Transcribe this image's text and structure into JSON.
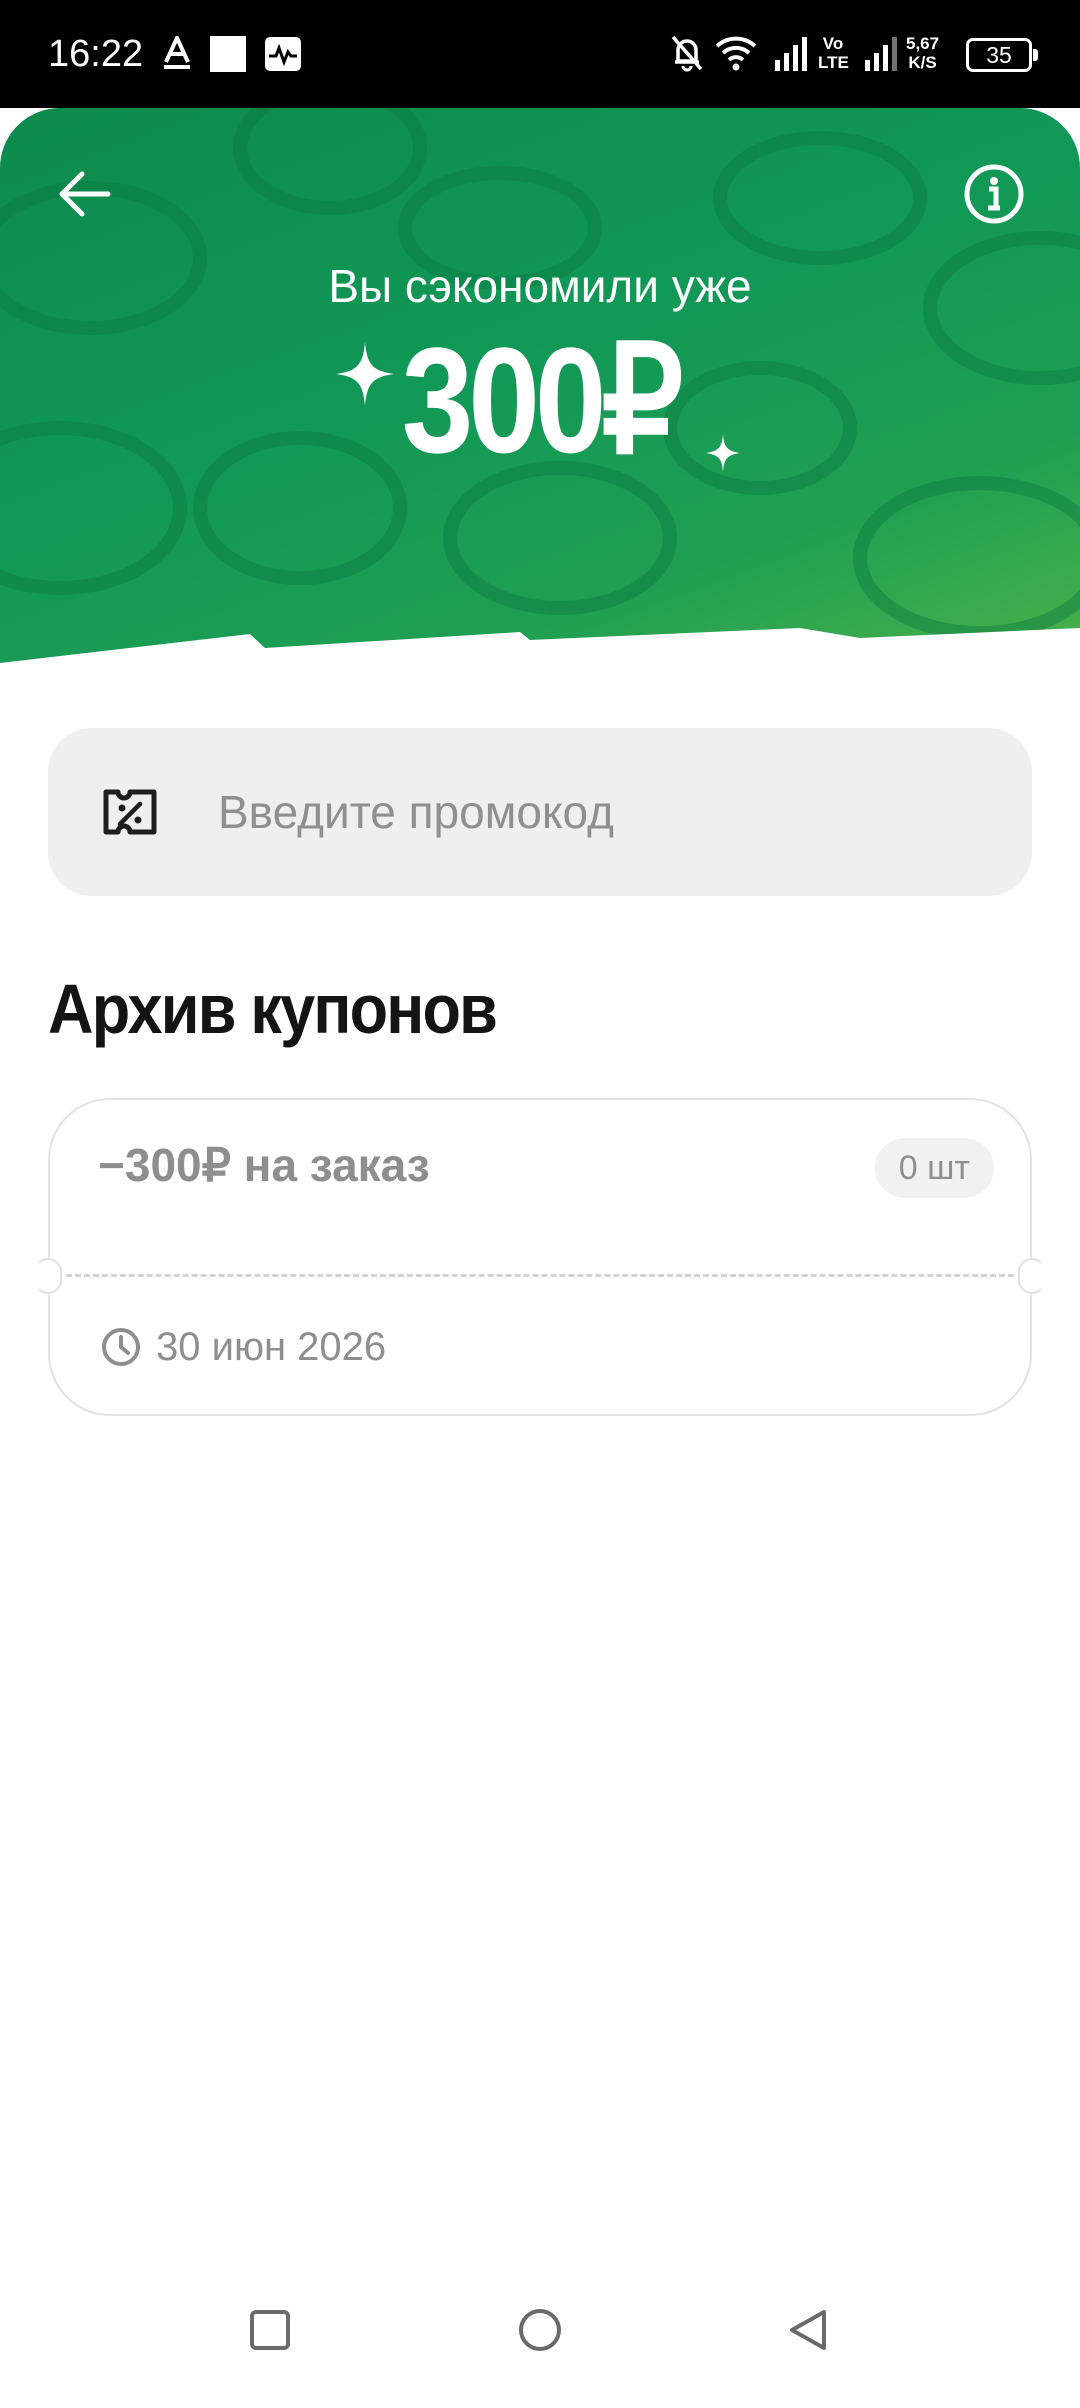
{
  "status_bar": {
    "time": "16:22",
    "network_label": "Vo LTE",
    "speed_value": "5,67",
    "speed_unit": "K/S",
    "battery": "35",
    "icons": [
      "a-notification-icon",
      "square-notification-icon",
      "activity-icon",
      "bell-off-icon",
      "wifi-icon",
      "signal-icon",
      "signal-icon-2",
      "battery-icon"
    ]
  },
  "header": {
    "caption": "Вы сэкономили уже",
    "amount": "300₽",
    "colors": {
      "green_dark": "#0c8a4c",
      "green_light": "#4db24a"
    }
  },
  "promo": {
    "placeholder": "Введите промокод",
    "value": ""
  },
  "archive": {
    "title": "Архив купонов",
    "coupons": [
      {
        "title": "−300₽ на заказ",
        "count": "0 шт",
        "expiry": "30 июн 2026"
      }
    ]
  },
  "nav": {
    "icons": [
      "recent-apps-icon",
      "home-icon",
      "back-icon"
    ]
  }
}
